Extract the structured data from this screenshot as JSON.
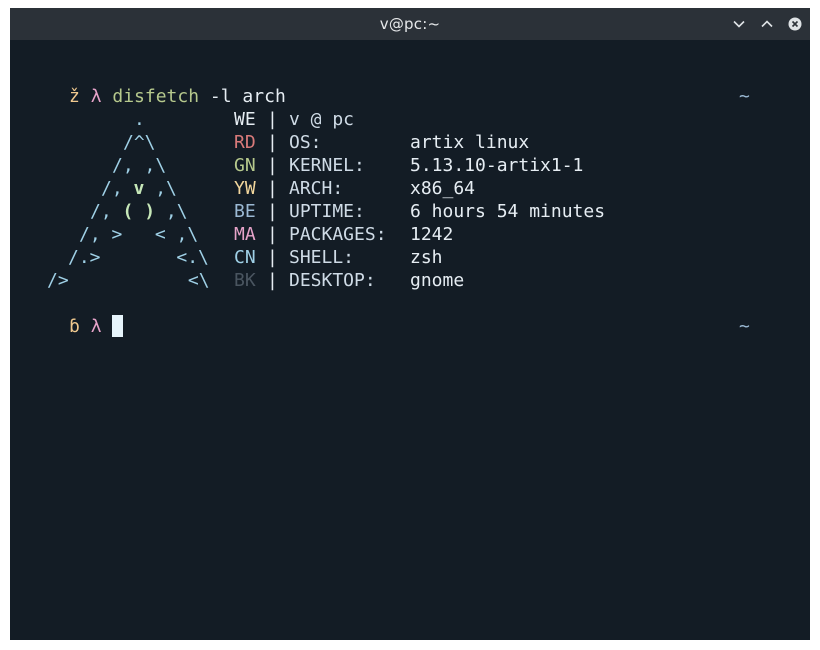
{
  "window": {
    "title": "v@pc:~",
    "buttons": {
      "minimize": "minimize",
      "maximize": "maximize",
      "close": "close"
    }
  },
  "prompt1": {
    "glyph": "ž",
    "lambda": "λ",
    "command": "disfetch",
    "args": "-l arch",
    "cwd": "~"
  },
  "art": [
    ".",
    "/^\\",
    "/, ,\\",
    "/,",
    "v",
    ",\\",
    "/,",
    "( )",
    ",\\",
    "/, >   < ,\\",
    "/.>       <.\\",
    "/>           <\\"
  ],
  "info": [
    {
      "code": "WE",
      "key": "v @ pc",
      "value": ""
    },
    {
      "code": "RD",
      "key": "OS:",
      "value": "artix linux"
    },
    {
      "code": "GN",
      "key": "KERNEL:",
      "value": "5.13.10-artix1-1"
    },
    {
      "code": "YW",
      "key": "ARCH:",
      "value": "x86_64"
    },
    {
      "code": "BE",
      "key": "UPTIME:",
      "value": "6 hours 54 minutes"
    },
    {
      "code": "MA",
      "key": "PACKAGES:",
      "value": "1242"
    },
    {
      "code": "CN",
      "key": "SHELL:",
      "value": "zsh"
    },
    {
      "code": "BK",
      "key": "DESKTOP:",
      "value": "gnome"
    }
  ],
  "separator": "|",
  "prompt2": {
    "glyph": "ɓ",
    "lambda": "λ",
    "cwd": "~"
  }
}
